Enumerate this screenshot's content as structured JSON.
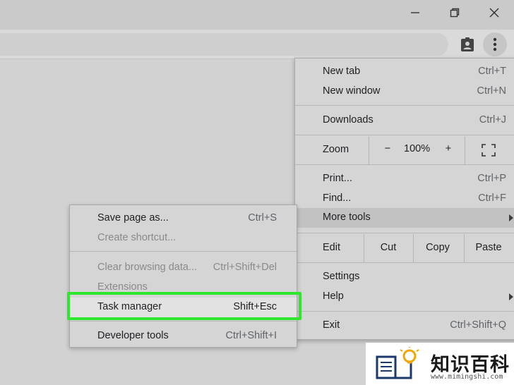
{
  "window": {
    "minimize_icon": "minimize-icon",
    "restore_icon": "restore-icon",
    "close_icon": "close-icon"
  },
  "toolbar": {
    "profile_icon": "profile-badge-icon",
    "menu_icon": "three-dots-vertical-icon"
  },
  "menu": {
    "items": [
      {
        "label": "New tab",
        "shortcut": "Ctrl+T"
      },
      {
        "label": "New window",
        "shortcut": "Ctrl+N"
      },
      {
        "label": "Downloads",
        "shortcut": "Ctrl+J"
      },
      {
        "label": "Print...",
        "shortcut": "Ctrl+P"
      },
      {
        "label": "Find...",
        "shortcut": "Ctrl+F"
      },
      {
        "label": "More tools",
        "shortcut": ""
      },
      {
        "label": "Settings",
        "shortcut": ""
      },
      {
        "label": "Help",
        "shortcut": ""
      },
      {
        "label": "Exit",
        "shortcut": "Ctrl+Shift+Q"
      }
    ],
    "zoom": {
      "label": "Zoom",
      "minus": "−",
      "value": "100%",
      "plus": "+",
      "fullscreen_icon": "fullscreen-icon"
    },
    "edit": {
      "label": "Edit",
      "cut": "Cut",
      "copy": "Copy",
      "paste": "Paste"
    }
  },
  "submenu": {
    "items": [
      {
        "label": "Save page as...",
        "shortcut": "Ctrl+S"
      },
      {
        "label": "Create shortcut...",
        "shortcut": ""
      },
      {
        "label": "Clear browsing data...",
        "shortcut": "Ctrl+Shift+Del"
      },
      {
        "label": "Extensions",
        "shortcut": ""
      },
      {
        "label": "Task manager",
        "shortcut": "Shift+Esc"
      },
      {
        "label": "Developer tools",
        "shortcut": "Ctrl+Shift+I"
      }
    ]
  },
  "colors": {
    "highlight_box": "#2ee62e"
  },
  "watermark": {
    "title": "知识百科",
    "url": "www.mimingshi.com",
    "icon": "book-lightbulb-logo-icon"
  }
}
